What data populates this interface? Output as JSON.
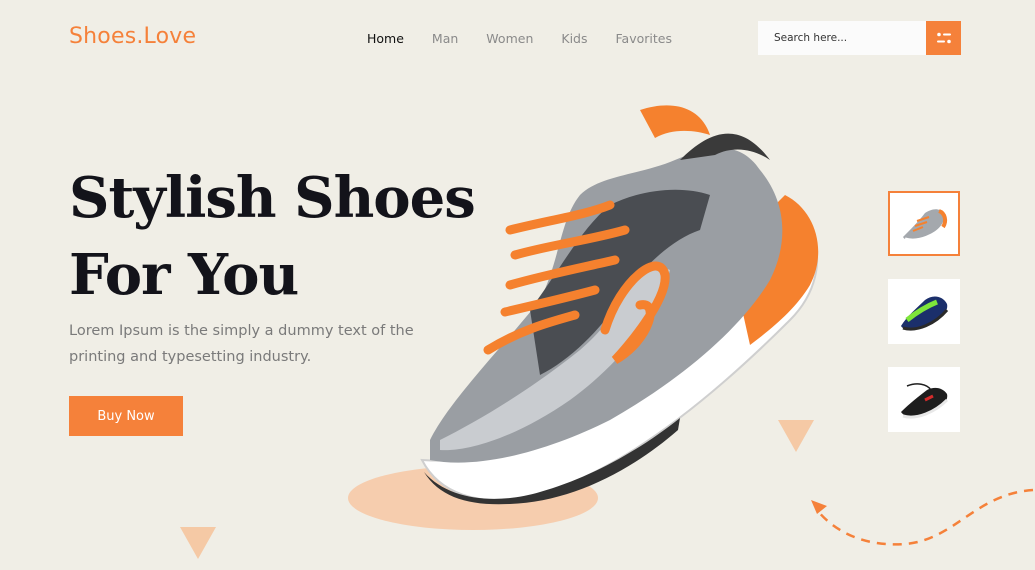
{
  "brand": {
    "name": "Shoes.Love",
    "accent": "#f5813a"
  },
  "nav": {
    "items": [
      {
        "label": "Home",
        "active": true
      },
      {
        "label": "Man",
        "active": false
      },
      {
        "label": "Women",
        "active": false
      },
      {
        "label": "Kids",
        "active": false
      },
      {
        "label": "Favorites",
        "active": false
      }
    ]
  },
  "search": {
    "placeholder": "Search here...",
    "value": "",
    "button_icon": "filter-icon"
  },
  "hero": {
    "title_line1": "Stylish Shoes",
    "title_line2": "For You",
    "description": "Lorem Ipsum is the simply a dummy text of the printing and typesetting industry.",
    "cta_label": "Buy Now",
    "image": "running-shoe-orange-gray"
  },
  "thumbnails": [
    {
      "image": "gray-orange-running-shoe",
      "selected": true
    },
    {
      "image": "blue-green-running-shoe",
      "selected": false
    },
    {
      "image": "black-red-running-shoe",
      "selected": false
    }
  ],
  "colors": {
    "background": "#f0eee6",
    "dark_text": "#13131a",
    "muted_text": "#7a7a7a"
  }
}
